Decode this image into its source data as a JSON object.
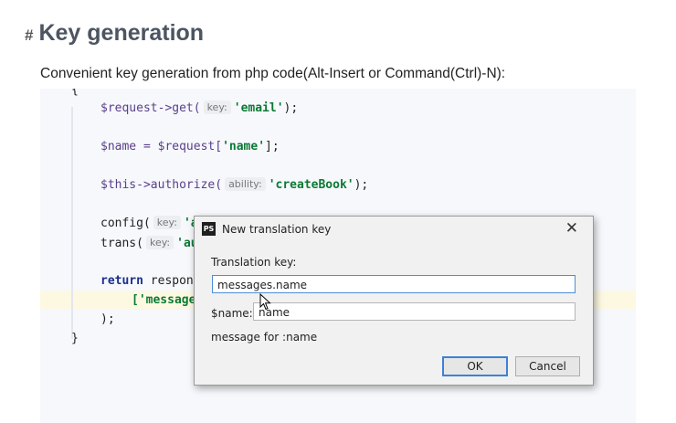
{
  "heading": {
    "hash": "#",
    "title": "Key generation"
  },
  "intro": "Convenient key generation from php code(Alt-Insert or Command(Ctrl)-N):",
  "code": {
    "line0": "{",
    "l1_a": "$request->get(",
    "l1_hint": "key:",
    "l1_str": "'email'",
    "l1_end": ");",
    "l2_a": "$name = $request[",
    "l2_str": "'name'",
    "l2_end": "];",
    "l3_a": "$this->authorize(",
    "l3_hint": "ability:",
    "l3_str": "'createBook'",
    "l3_end": ");",
    "l4_a": "config(",
    "l4_hint": "key:",
    "l4_str": "'a",
    "l5_a": "trans(",
    "l5_hint": "key:",
    "l5_str": "'au",
    "l6_kw": "return",
    "l6_rest": " respon",
    "l7_str": "['message",
    "l8": ");",
    "l9": "}"
  },
  "dialog": {
    "logo": "PS",
    "title": "New translation key",
    "close": "✕",
    "key_label": "Translation key:",
    "key_value": "messages.name",
    "name_label": "$name:",
    "name_value": "name",
    "message": "message for :name",
    "ok": "OK",
    "cancel": "Cancel"
  }
}
